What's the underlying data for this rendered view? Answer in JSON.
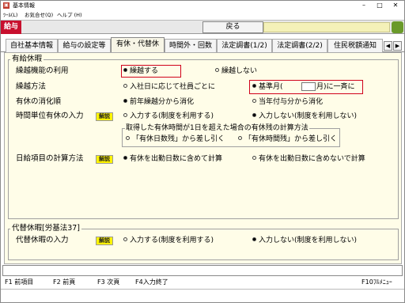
{
  "window": {
    "title": "基本情報",
    "menu": [
      "ﾂｰﾙ(L)",
      "お気合せ(Q)",
      "ヘルプ (H)"
    ],
    "controls": [
      "–",
      "□",
      "✕"
    ]
  },
  "toolbar": {
    "app_label": "給与",
    "back_button": "戻る"
  },
  "tabs": [
    {
      "label": "自社基本情報"
    },
    {
      "label": "給与の設定等"
    },
    {
      "label": "有休・代替休"
    },
    {
      "label": "時間外・回数"
    },
    {
      "label": "法定調書(1/2)"
    },
    {
      "label": "法定調書(2/2)"
    },
    {
      "label": "住民税額通知"
    }
  ],
  "scroll": {
    "left": "◀",
    "right": "▶"
  },
  "paid_leave": {
    "section_title": "有給休暇",
    "carryover": {
      "label": "繰越機能の利用",
      "opt1": "繰越する",
      "opt2": "繰越しない"
    },
    "carry_method": {
      "label": "繰越方法",
      "opt1": "入社日に応じて社員ごとに",
      "opt2_pre": "基準月(",
      "opt2_post": "月)に一斉に"
    },
    "usage_order": {
      "label": "有休の消化順",
      "opt1": "前年繰越分から消化",
      "opt2": "当年付与分から消化"
    },
    "hourly": {
      "label": "時間単位有休の入力",
      "help": "解説",
      "opt1": "入力する(制度を利用する)",
      "opt2": "入力しない(制度を利用しない)",
      "group_title": "取得した有休時間が1日を超えた場合の有休残の計算方法",
      "sub1": "「有休日数残」から差し引く",
      "sub2": "「有休時間残」から差し引く"
    },
    "salary_calc": {
      "label": "日給項目の計算方法",
      "help": "解説",
      "opt1": "有休を出勤日数に含めて計算",
      "opt2": "有休を出勤日数に含めないで計算"
    }
  },
  "substitute": {
    "section_title": "代替休暇[労基法37]",
    "label": "代替休暇の入力",
    "help": "解説",
    "opt1": "入力する(制度を利用する)",
    "opt2": "入力しない(制度を利用しない)"
  },
  "fkeys": [
    {
      "label": "F1 前項目"
    },
    {
      "label": "F2 前頁"
    },
    {
      "label": "F3 次頁"
    },
    {
      "label": "F4入力終了"
    },
    {
      "label": "F10ﾌﾙﾒﾆｭｰ"
    }
  ]
}
